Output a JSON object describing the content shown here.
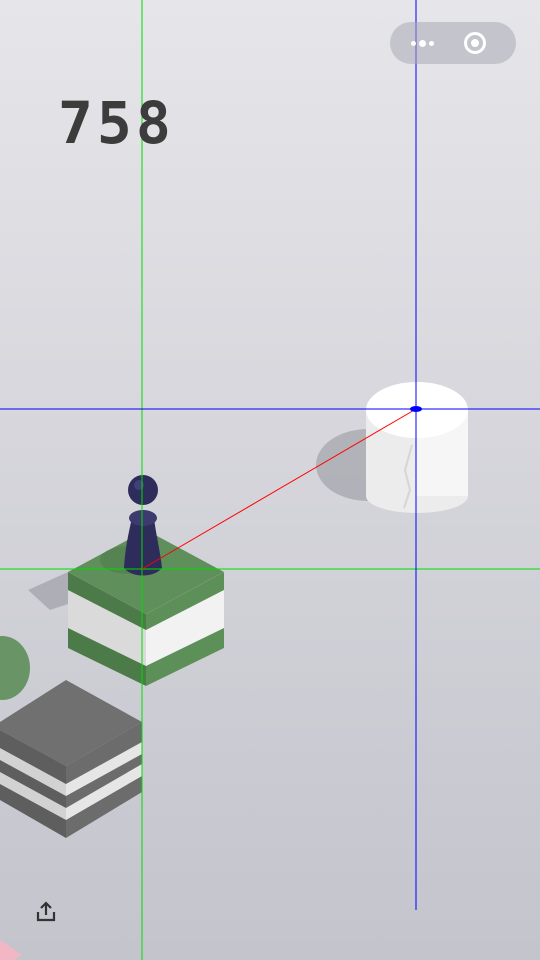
{
  "score": "758",
  "top_bar": {
    "more_icon": "more-dots-icon",
    "close_icon": "target-circle-icon"
  },
  "share": {
    "icon": "share-upload-icon"
  },
  "colors": {
    "score_text": "#3c3c3c",
    "player": "#2e2c5a",
    "current_block_top": "#5c8b58",
    "target_top": "#ffffff",
    "guide_vertical": "#00dd00",
    "guide_target": "#0000ff",
    "aim_line": "#ff0000"
  }
}
